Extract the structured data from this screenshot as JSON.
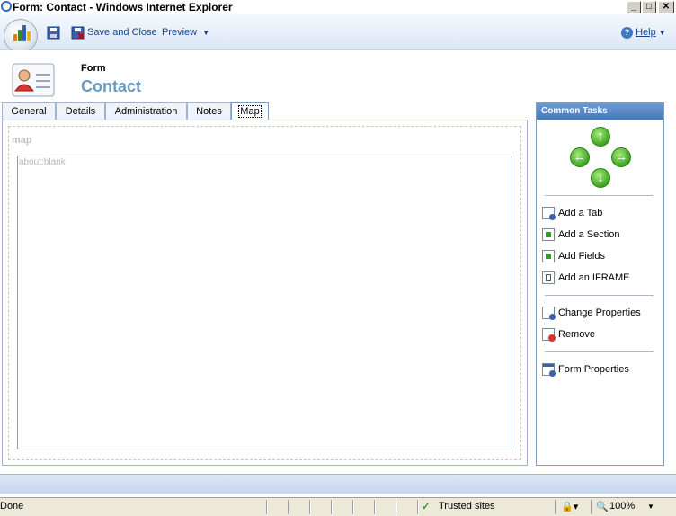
{
  "window": {
    "title": "Form: Contact - Windows Internet Explorer",
    "min": "_",
    "max": "□",
    "close": "✕"
  },
  "toolbar": {
    "save_close": "Save and Close",
    "preview": "Preview",
    "help": "Help"
  },
  "header": {
    "form_label": "Form",
    "form_name": "Contact"
  },
  "tabs": [
    {
      "label": "General"
    },
    {
      "label": "Details"
    },
    {
      "label": "Administration"
    },
    {
      "label": "Notes"
    },
    {
      "label": "Map"
    }
  ],
  "main": {
    "section_title": "map",
    "iframe_url": "about:blank"
  },
  "tasks": {
    "header": "Common Tasks",
    "items": [
      {
        "label": "Add a Tab",
        "icon": "add-tab-icon"
      },
      {
        "label": "Add a Section",
        "icon": "add-section-icon"
      },
      {
        "label": "Add Fields",
        "icon": "add-fields-icon"
      },
      {
        "label": "Add an IFRAME",
        "icon": "add-iframe-icon"
      },
      {
        "label": "Change Properties",
        "icon": "change-properties-icon"
      },
      {
        "label": "Remove",
        "icon": "remove-icon"
      },
      {
        "label": "Form Properties",
        "icon": "form-properties-icon"
      }
    ]
  },
  "status": {
    "left": "Done",
    "zone": "Trusted sites",
    "zoom": "100%"
  },
  "colors": {
    "accent": "#15428b",
    "header_blue": "#6a9bc3",
    "task_header": "#4a78b8"
  }
}
